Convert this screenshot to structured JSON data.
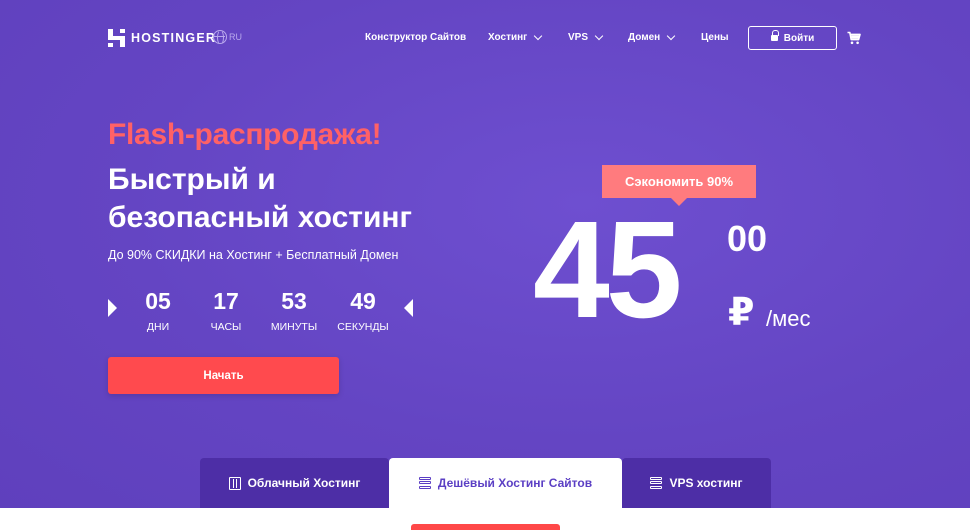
{
  "header": {
    "brand": "HOSTINGER",
    "lang": "RU",
    "nav": [
      {
        "label": "Конструктор Сайтов",
        "dropdown": false
      },
      {
        "label": "Хостинг",
        "dropdown": true
      },
      {
        "label": "VPS",
        "dropdown": true
      },
      {
        "label": "Домен",
        "dropdown": true
      },
      {
        "label": "Цены",
        "dropdown": false
      }
    ],
    "login_label": "Войти"
  },
  "hero": {
    "flash": "Flash-распродажа!",
    "headline_line1": "Быстрый и",
    "headline_line2": "безопасный хостинг",
    "subline": "До 90% СКИДКИ на Хостинг + Бесплатный Домен",
    "countdown": {
      "days": {
        "value": "05",
        "label": "ДНИ"
      },
      "hours": {
        "value": "17",
        "label": "ЧАСЫ"
      },
      "minutes": {
        "value": "53",
        "label": "МИНУТЫ"
      },
      "seconds": {
        "value": "49",
        "label": "СЕКУНДЫ"
      }
    },
    "start_label": "Начать"
  },
  "price": {
    "badge": "Сэкономить 90%",
    "main": "45",
    "cents": "00",
    "currency": "₽",
    "period": "/мес"
  },
  "tabs": [
    {
      "label": "Облачный Хостинг",
      "icon": "server-grid-icon",
      "active": false
    },
    {
      "label": "Дешёвый Хостинг Сайтов",
      "icon": "server-stack-icon",
      "active": true
    },
    {
      "label": "VPS хостинг",
      "icon": "server-stack-icon",
      "active": false
    }
  ],
  "colors": {
    "background": "#6747c7",
    "accent": "#ff4a4e",
    "flash_text": "#ff6166",
    "badge": "#ff7b7e",
    "tab_dark": "#4d2ea6",
    "tab_active_text": "#5b3fc4"
  }
}
